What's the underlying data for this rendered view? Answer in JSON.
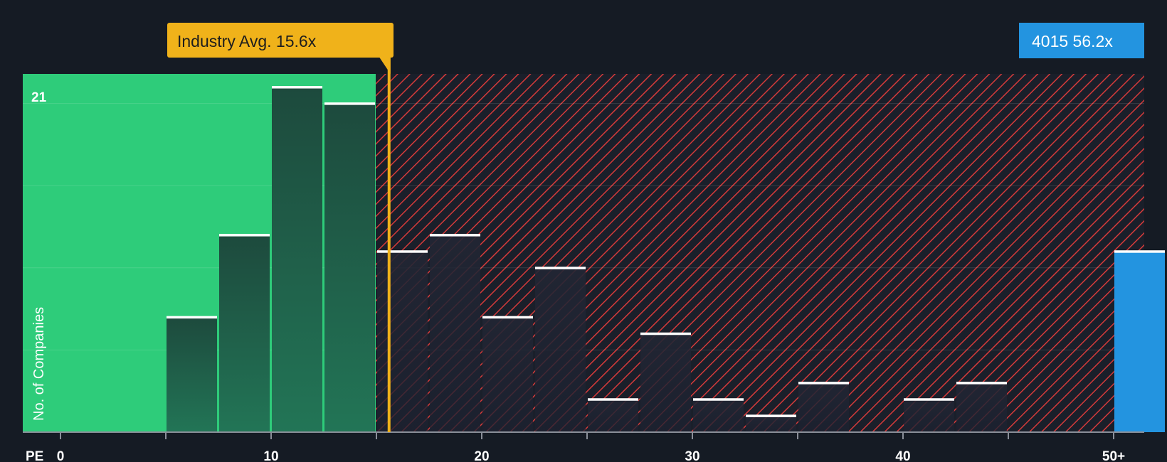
{
  "chart_data": {
    "type": "bar",
    "x_axis_label": "PE",
    "y_axis_label": "No. of Companies",
    "y_max_label": "21",
    "ylim": [
      0,
      21.8
    ],
    "x_ticks": [
      {
        "value": 0,
        "label": "0"
      },
      {
        "value": 10,
        "label": "10"
      },
      {
        "value": 20,
        "label": "20"
      },
      {
        "value": 30,
        "label": "30"
      },
      {
        "value": 40,
        "label": "40"
      },
      {
        "value": 50,
        "label": "50+"
      }
    ],
    "bins": [
      {
        "start": 5.0,
        "end": 7.5,
        "count": 7
      },
      {
        "start": 7.5,
        "end": 10.0,
        "count": 12
      },
      {
        "start": 10.0,
        "end": 12.5,
        "count": 21
      },
      {
        "start": 12.5,
        "end": 15.0,
        "count": 20
      },
      {
        "start": 15.0,
        "end": 17.5,
        "count": 11
      },
      {
        "start": 17.5,
        "end": 20.0,
        "count": 12
      },
      {
        "start": 20.0,
        "end": 22.5,
        "count": 7
      },
      {
        "start": 22.5,
        "end": 25.0,
        "count": 10
      },
      {
        "start": 25.0,
        "end": 27.5,
        "count": 2
      },
      {
        "start": 27.5,
        "end": 30.0,
        "count": 6
      },
      {
        "start": 30.0,
        "end": 32.5,
        "count": 2
      },
      {
        "start": 32.5,
        "end": 35.0,
        "count": 1
      },
      {
        "start": 35.0,
        "end": 37.5,
        "count": 3
      },
      {
        "start": 40.0,
        "end": 42.5,
        "count": 2
      },
      {
        "start": 42.5,
        "end": 45.0,
        "count": 3
      },
      {
        "start": 50.0,
        "end": 52.5,
        "count": 11,
        "highlight": true
      }
    ],
    "fair_range_end": 15.0,
    "industry_avg": {
      "value": 15.6,
      "label": "Industry Avg. 15.6x"
    },
    "company": {
      "value": 56.2,
      "label": "4015 56.2x"
    },
    "colors": {
      "background": "#151b24",
      "green_zone": "#2ecc7a",
      "bar_green": "#1f4d3c",
      "red_hatch": "#d43a3a",
      "industry_callout": "#f0b21a",
      "company_callout": "#2394e0"
    }
  }
}
